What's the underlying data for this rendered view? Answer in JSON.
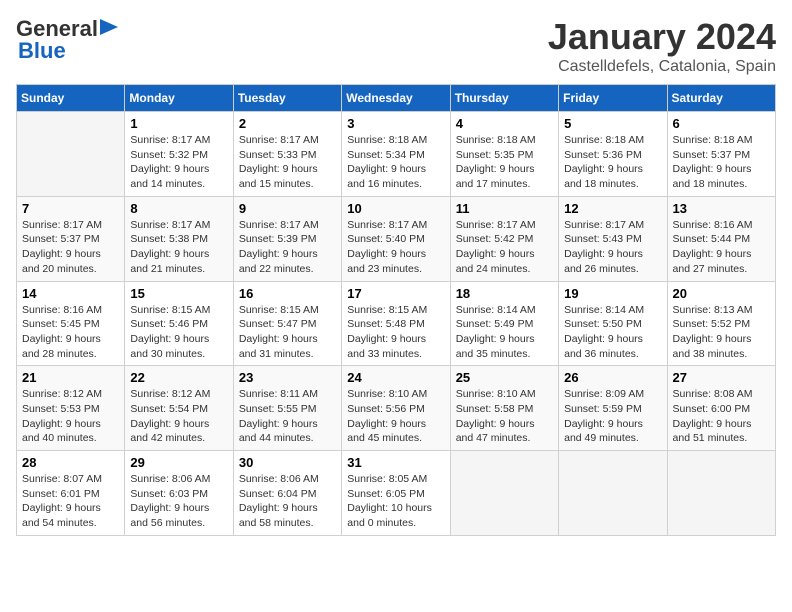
{
  "header": {
    "logo_general": "General",
    "logo_blue": "Blue",
    "month_title": "January 2024",
    "location": "Castelldefels, Catalonia, Spain"
  },
  "weekdays": [
    "Sunday",
    "Monday",
    "Tuesday",
    "Wednesday",
    "Thursday",
    "Friday",
    "Saturday"
  ],
  "weeks": [
    [
      {
        "day": "",
        "info": ""
      },
      {
        "day": "1",
        "info": "Sunrise: 8:17 AM\nSunset: 5:32 PM\nDaylight: 9 hours\nand 14 minutes."
      },
      {
        "day": "2",
        "info": "Sunrise: 8:17 AM\nSunset: 5:33 PM\nDaylight: 9 hours\nand 15 minutes."
      },
      {
        "day": "3",
        "info": "Sunrise: 8:18 AM\nSunset: 5:34 PM\nDaylight: 9 hours\nand 16 minutes."
      },
      {
        "day": "4",
        "info": "Sunrise: 8:18 AM\nSunset: 5:35 PM\nDaylight: 9 hours\nand 17 minutes."
      },
      {
        "day": "5",
        "info": "Sunrise: 8:18 AM\nSunset: 5:36 PM\nDaylight: 9 hours\nand 18 minutes."
      },
      {
        "day": "6",
        "info": "Sunrise: 8:18 AM\nSunset: 5:37 PM\nDaylight: 9 hours\nand 18 minutes."
      }
    ],
    [
      {
        "day": "7",
        "info": "Sunrise: 8:17 AM\nSunset: 5:37 PM\nDaylight: 9 hours\nand 20 minutes."
      },
      {
        "day": "8",
        "info": "Sunrise: 8:17 AM\nSunset: 5:38 PM\nDaylight: 9 hours\nand 21 minutes."
      },
      {
        "day": "9",
        "info": "Sunrise: 8:17 AM\nSunset: 5:39 PM\nDaylight: 9 hours\nand 22 minutes."
      },
      {
        "day": "10",
        "info": "Sunrise: 8:17 AM\nSunset: 5:40 PM\nDaylight: 9 hours\nand 23 minutes."
      },
      {
        "day": "11",
        "info": "Sunrise: 8:17 AM\nSunset: 5:42 PM\nDaylight: 9 hours\nand 24 minutes."
      },
      {
        "day": "12",
        "info": "Sunrise: 8:17 AM\nSunset: 5:43 PM\nDaylight: 9 hours\nand 26 minutes."
      },
      {
        "day": "13",
        "info": "Sunrise: 8:16 AM\nSunset: 5:44 PM\nDaylight: 9 hours\nand 27 minutes."
      }
    ],
    [
      {
        "day": "14",
        "info": "Sunrise: 8:16 AM\nSunset: 5:45 PM\nDaylight: 9 hours\nand 28 minutes."
      },
      {
        "day": "15",
        "info": "Sunrise: 8:15 AM\nSunset: 5:46 PM\nDaylight: 9 hours\nand 30 minutes."
      },
      {
        "day": "16",
        "info": "Sunrise: 8:15 AM\nSunset: 5:47 PM\nDaylight: 9 hours\nand 31 minutes."
      },
      {
        "day": "17",
        "info": "Sunrise: 8:15 AM\nSunset: 5:48 PM\nDaylight: 9 hours\nand 33 minutes."
      },
      {
        "day": "18",
        "info": "Sunrise: 8:14 AM\nSunset: 5:49 PM\nDaylight: 9 hours\nand 35 minutes."
      },
      {
        "day": "19",
        "info": "Sunrise: 8:14 AM\nSunset: 5:50 PM\nDaylight: 9 hours\nand 36 minutes."
      },
      {
        "day": "20",
        "info": "Sunrise: 8:13 AM\nSunset: 5:52 PM\nDaylight: 9 hours\nand 38 minutes."
      }
    ],
    [
      {
        "day": "21",
        "info": "Sunrise: 8:12 AM\nSunset: 5:53 PM\nDaylight: 9 hours\nand 40 minutes."
      },
      {
        "day": "22",
        "info": "Sunrise: 8:12 AM\nSunset: 5:54 PM\nDaylight: 9 hours\nand 42 minutes."
      },
      {
        "day": "23",
        "info": "Sunrise: 8:11 AM\nSunset: 5:55 PM\nDaylight: 9 hours\nand 44 minutes."
      },
      {
        "day": "24",
        "info": "Sunrise: 8:10 AM\nSunset: 5:56 PM\nDaylight: 9 hours\nand 45 minutes."
      },
      {
        "day": "25",
        "info": "Sunrise: 8:10 AM\nSunset: 5:58 PM\nDaylight: 9 hours\nand 47 minutes."
      },
      {
        "day": "26",
        "info": "Sunrise: 8:09 AM\nSunset: 5:59 PM\nDaylight: 9 hours\nand 49 minutes."
      },
      {
        "day": "27",
        "info": "Sunrise: 8:08 AM\nSunset: 6:00 PM\nDaylight: 9 hours\nand 51 minutes."
      }
    ],
    [
      {
        "day": "28",
        "info": "Sunrise: 8:07 AM\nSunset: 6:01 PM\nDaylight: 9 hours\nand 54 minutes."
      },
      {
        "day": "29",
        "info": "Sunrise: 8:06 AM\nSunset: 6:03 PM\nDaylight: 9 hours\nand 56 minutes."
      },
      {
        "day": "30",
        "info": "Sunrise: 8:06 AM\nSunset: 6:04 PM\nDaylight: 9 hours\nand 58 minutes."
      },
      {
        "day": "31",
        "info": "Sunrise: 8:05 AM\nSunset: 6:05 PM\nDaylight: 10 hours\nand 0 minutes."
      },
      {
        "day": "",
        "info": ""
      },
      {
        "day": "",
        "info": ""
      },
      {
        "day": "",
        "info": ""
      }
    ]
  ]
}
